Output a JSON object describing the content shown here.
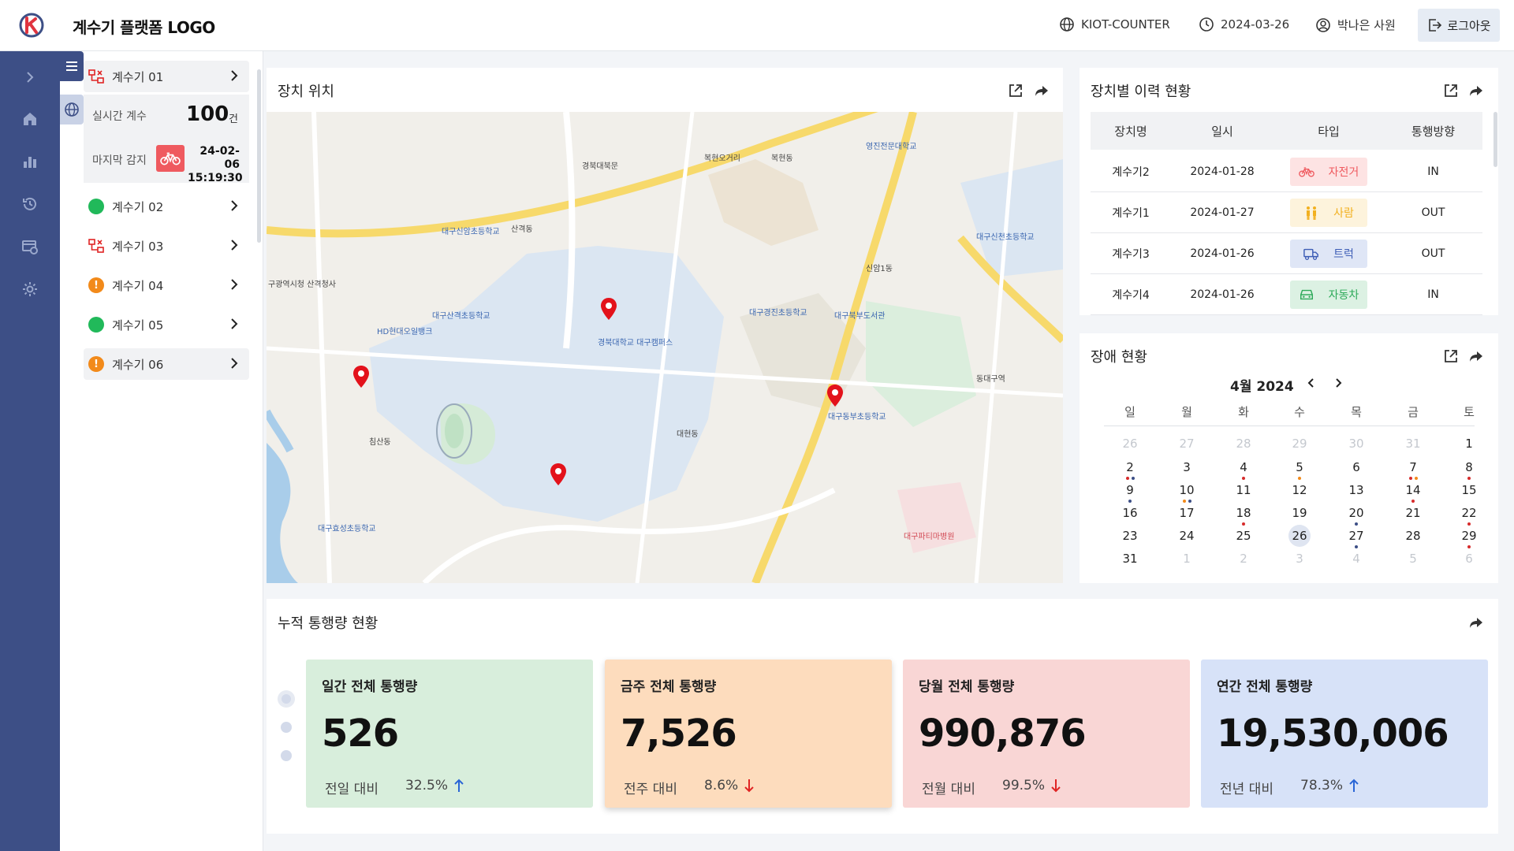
{
  "header": {
    "app_title": "계수기 플랫폼 LOGO",
    "site": "KIOT-COUNTER",
    "date": "2024-03-26",
    "user": "박나은 사원",
    "logout_label": "로그아웃"
  },
  "devices": {
    "items": [
      {
        "label": "계수기 01",
        "status": "error"
      },
      {
        "label": "계수기 02",
        "status": "normal"
      },
      {
        "label": "계수기 03",
        "status": "error"
      },
      {
        "label": "계수기 04",
        "status": "warning"
      },
      {
        "label": "계수기 05",
        "status": "normal"
      },
      {
        "label": "계수기 06",
        "status": "warning"
      }
    ],
    "detail": {
      "realtime_label": "실시간 계수",
      "realtime_count": "100",
      "realtime_unit": "건",
      "last_detect_label": "마지막 감지",
      "last_date": "24-02-06",
      "last_time": "15:19:30"
    }
  },
  "map_card": {
    "title": "장치 위치",
    "labels": [
      "대구신암초등학교",
      "경북대학교 대구캠퍼스",
      "대구동부초등학교",
      "대구경진초등학교",
      "구광역시청 산격청사",
      "복현오거리",
      "대구산격초등학교",
      "HD현대오일뱅크",
      "신암1동",
      "동대구역",
      "대현동",
      "산격동",
      "침산동",
      "복현동",
      "대구파티마병원",
      "대구북부도서관",
      "경북대북문",
      "영진전문대학교",
      "대구신천초등학교",
      "대구효성초등학교"
    ]
  },
  "history_card": {
    "title": "장치별 이력 현황",
    "columns": [
      "장치명",
      "일시",
      "타입",
      "통행방향"
    ],
    "rows": [
      {
        "device": "계수기2",
        "date": "2024-01-28",
        "type": "자전거",
        "icon": "bicycle-icon",
        "direction": "IN"
      },
      {
        "device": "계수기1",
        "date": "2024-01-27",
        "type": "사람",
        "icon": "person-icon",
        "direction": "OUT"
      },
      {
        "device": "계수기3",
        "date": "2024-01-26",
        "type": "트럭",
        "icon": "truck-icon",
        "direction": "OUT"
      },
      {
        "device": "계수기4",
        "date": "2024-01-26",
        "type": "자동차",
        "icon": "car-icon",
        "direction": "IN"
      }
    ],
    "type_colors": {
      "자전거": "#ef5a5f",
      "사람": "#f2b01f",
      "트럭": "#3d5db6",
      "자동차": "#2eaa5a"
    }
  },
  "calendar_card": {
    "title": "장애 현황",
    "month_label": "4월 2024",
    "weekdays": [
      "일",
      "월",
      "화",
      "수",
      "목",
      "금",
      "토"
    ],
    "weeks": [
      [
        "26",
        "27",
        "28",
        "29",
        "30",
        "31",
        "1"
      ],
      [
        "2",
        "3",
        "4",
        "5",
        "6",
        "7",
        "8"
      ],
      [
        "9",
        "10",
        "11",
        "12",
        "13",
        "14",
        "15"
      ],
      [
        "16",
        "17",
        "18",
        "19",
        "20",
        "21",
        "22"
      ],
      [
        "23",
        "24",
        "25",
        "26",
        "27",
        "28",
        "29"
      ],
      [
        "31",
        "1",
        "2",
        "3",
        "4",
        "5",
        "6"
      ]
    ],
    "today": "26"
  },
  "traffic_card": {
    "title": "누적 통행량 현황",
    "stats": [
      {
        "title": "일간 전체 통행량",
        "value": "526",
        "compare": "전일 대비",
        "pct": "32.5%",
        "trend": "up",
        "bg": "#d8eedc"
      },
      {
        "title": "금주 전체 통행량",
        "value": "7,526",
        "compare": "전주 대비",
        "pct": "8.6%",
        "trend": "down",
        "bg": "#fddcbd"
      },
      {
        "title": "당월 전체 통행량",
        "value": "990,876",
        "compare": "전월 대비",
        "pct": "99.5%",
        "trend": "down",
        "bg": "#f9d6d5"
      },
      {
        "title": "연간 전체 통행량",
        "value": "19,530,006",
        "compare": "전년 대비",
        "pct": "78.3%",
        "trend": "up",
        "bg": "#d7e2f8"
      }
    ]
  },
  "colors": {
    "rail": "#3d4f86",
    "up": "#2a66d6",
    "down": "#e02424",
    "dot_red": "#d62b2b",
    "dot_blue": "#3d4f86",
    "dot_orange": "#f28a1a"
  }
}
